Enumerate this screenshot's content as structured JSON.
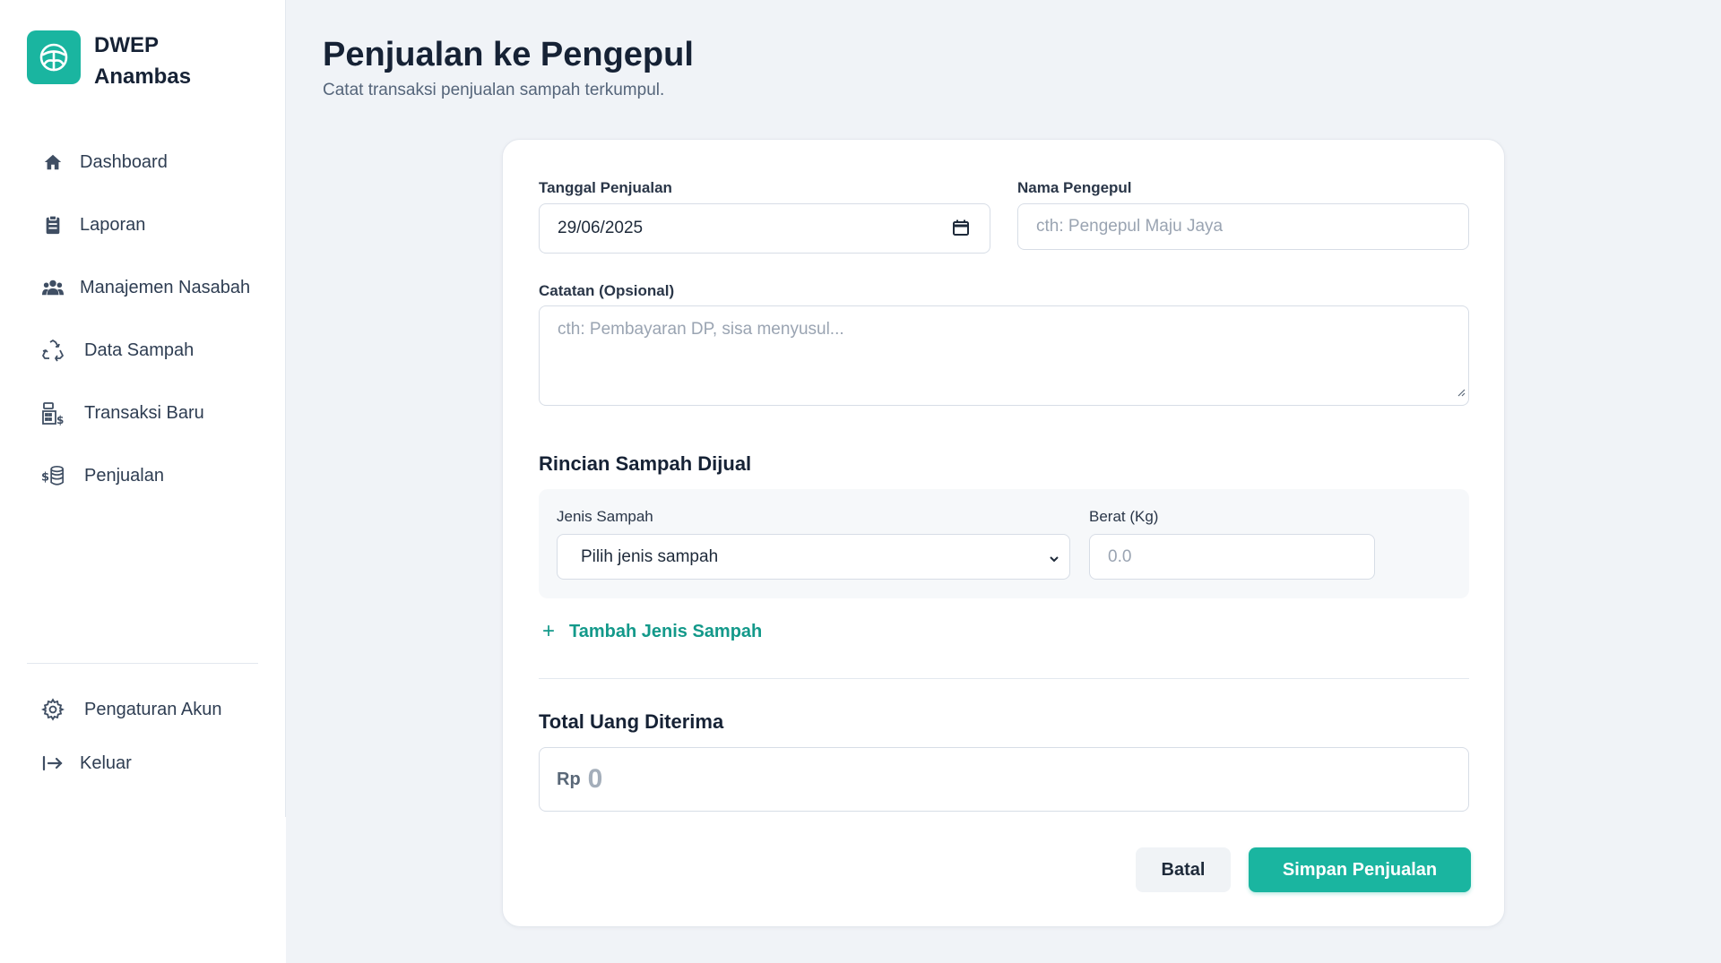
{
  "brand": {
    "name_line1": "DWEP",
    "name_line2": "Anambas"
  },
  "sidebar": {
    "items": [
      {
        "label": "Dashboard",
        "icon": "home-icon"
      },
      {
        "label": "Laporan",
        "icon": "clipboard-icon"
      },
      {
        "label": "Manajemen Nasabah",
        "icon": "users-icon"
      },
      {
        "label": "Data Sampah",
        "icon": "recycle-icon"
      },
      {
        "label": "Transaksi Baru",
        "icon": "cash-register-icon"
      },
      {
        "label": "Penjualan",
        "icon": "coins-icon"
      }
    ],
    "bottom": [
      {
        "label": "Pengaturan Akun",
        "icon": "gear-icon"
      },
      {
        "label": "Keluar",
        "icon": "logout-icon"
      }
    ]
  },
  "header": {
    "title": "Penjualan ke Pengepul",
    "subtitle": "Catat transaksi penjualan sampah terkumpul."
  },
  "form": {
    "date_label": "Tanggal Penjualan",
    "date_value": "29/06/2025",
    "collector_label": "Nama Pengepul",
    "collector_placeholder": "cth: Pengepul Maju Jaya",
    "notes_label": "Catatan (Opsional)",
    "notes_placeholder": "cth: Pembayaran DP, sisa menyusul...",
    "items_title": "Rincian Sampah Dijual",
    "type_label": "Jenis Sampah",
    "type_selected": "Pilih jenis sampah",
    "weight_label": "Berat (Kg)",
    "weight_placeholder": "0.0",
    "add_item": "Tambah Jenis Sampah",
    "total_title": "Total Uang Diterima",
    "currency": "Rp",
    "total_value": "0",
    "cancel": "Batal",
    "save": "Simpan Penjualan"
  },
  "colors": {
    "accent": "#1ab5a0",
    "link": "#13998a"
  }
}
